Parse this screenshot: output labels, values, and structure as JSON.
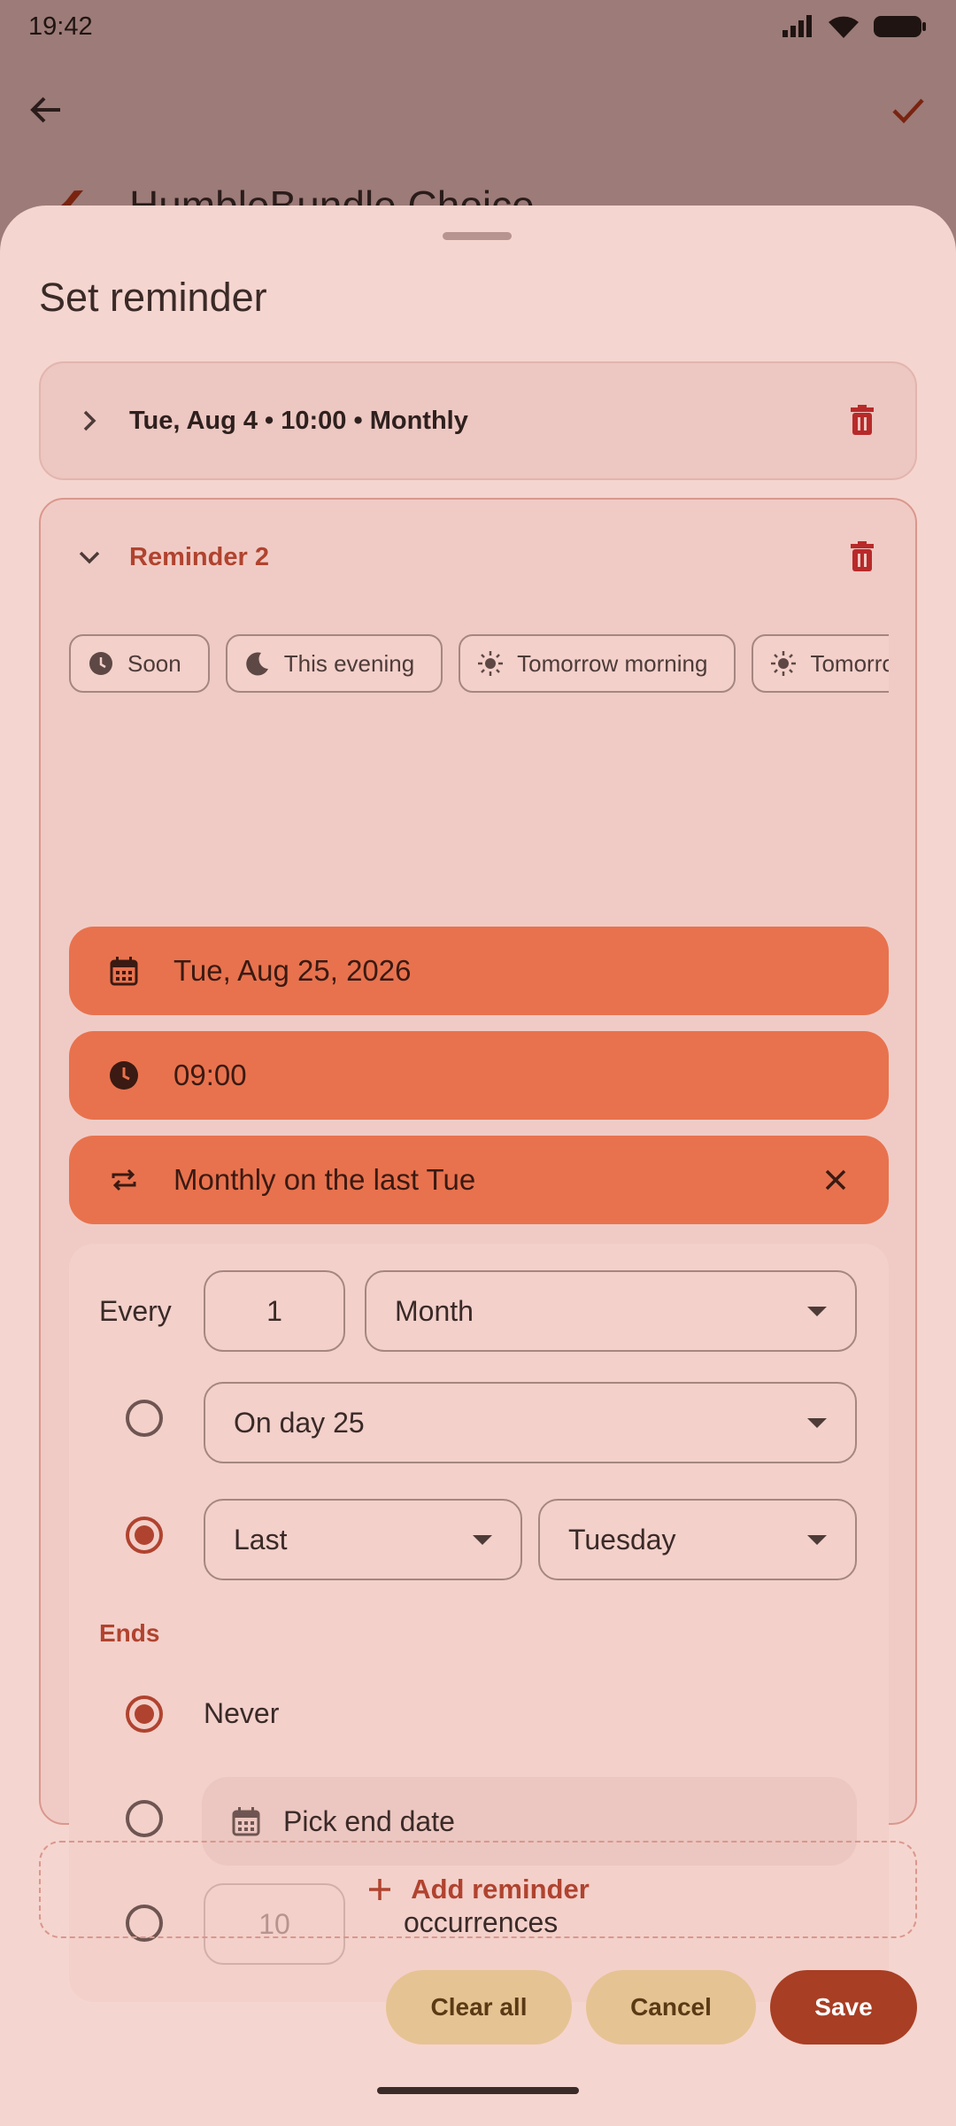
{
  "status_bar": {
    "time": "19:42"
  },
  "background_app": {
    "title": "HumbleBundle Choice"
  },
  "sheet": {
    "title": "Set reminder",
    "collapsed_reminder": {
      "summary": "Tue, Aug 4 • 10:00 • Monthly"
    },
    "expanded_reminder": {
      "label": "Reminder 2",
      "quick_chips": [
        "Soon",
        "This evening",
        "Tomorrow morning",
        "Tomorrow"
      ],
      "date": "Tue, Aug 25, 2026",
      "time": "09:00",
      "repeat": "Monthly on the last Tue",
      "repeat_panel": {
        "every_label": "Every",
        "interval": "1",
        "unit": "Month",
        "day_option": "On day 25",
        "ordinal": "Last",
        "weekday": "Tuesday",
        "day_option_selected": false,
        "ordinal_option_selected": true,
        "ends_label": "Ends",
        "never_label": "Never",
        "never_selected": true,
        "pick_end_date_label": "Pick end date",
        "occurrences_placeholder": "10",
        "occurrences_label": "occurrences"
      }
    },
    "add_reminder_label": "Add reminder",
    "buttons": {
      "clear_all": "Clear all",
      "cancel": "Cancel",
      "save": "Save"
    }
  },
  "colors": {
    "accent": "#b0432f",
    "orange_row": "#e8724e",
    "sheet_bg": "#f5d5cf",
    "tonal_button": "#e6c393",
    "primary_button": "#a83e24"
  }
}
